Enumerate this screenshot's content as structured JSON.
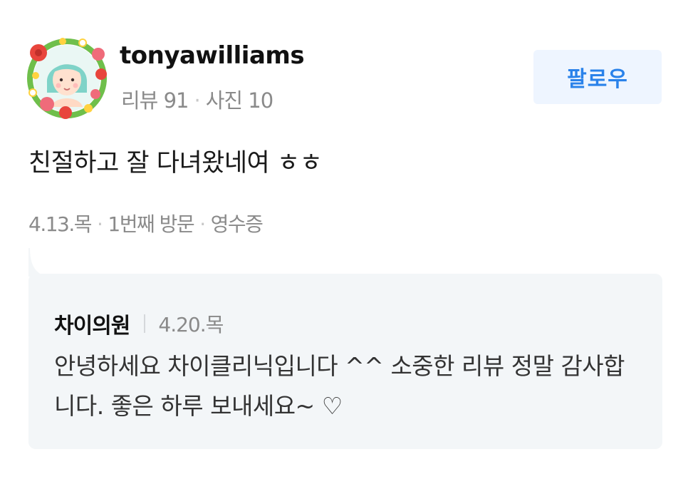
{
  "review": {
    "username": "tonyawilliams",
    "stats": {
      "reviews": "리뷰 91",
      "separator": "·",
      "photos": "사진 10"
    },
    "follow_label": "팔로우",
    "body": "친절하고 잘 다녀왔네여 ㅎㅎ",
    "meta": {
      "date": "4.13.목",
      "visit": "1번째 방문",
      "verification": "영수증",
      "separator": "·"
    }
  },
  "reply": {
    "owner": "차이의원",
    "date": "4.20.목",
    "text": "안녕하세요 차이클리닉입니다 ^^ 소중한 리뷰 정말 감사합니다. 좋은 하루 보내세요~ ♡"
  },
  "icons": {
    "avatar": "avatar-with-flower-wreath"
  },
  "colors": {
    "accent": "#2a82ea",
    "follow_bg": "#eef5ff",
    "reply_bg": "#f3f6f8",
    "muted_text": "#8a8a8a"
  }
}
